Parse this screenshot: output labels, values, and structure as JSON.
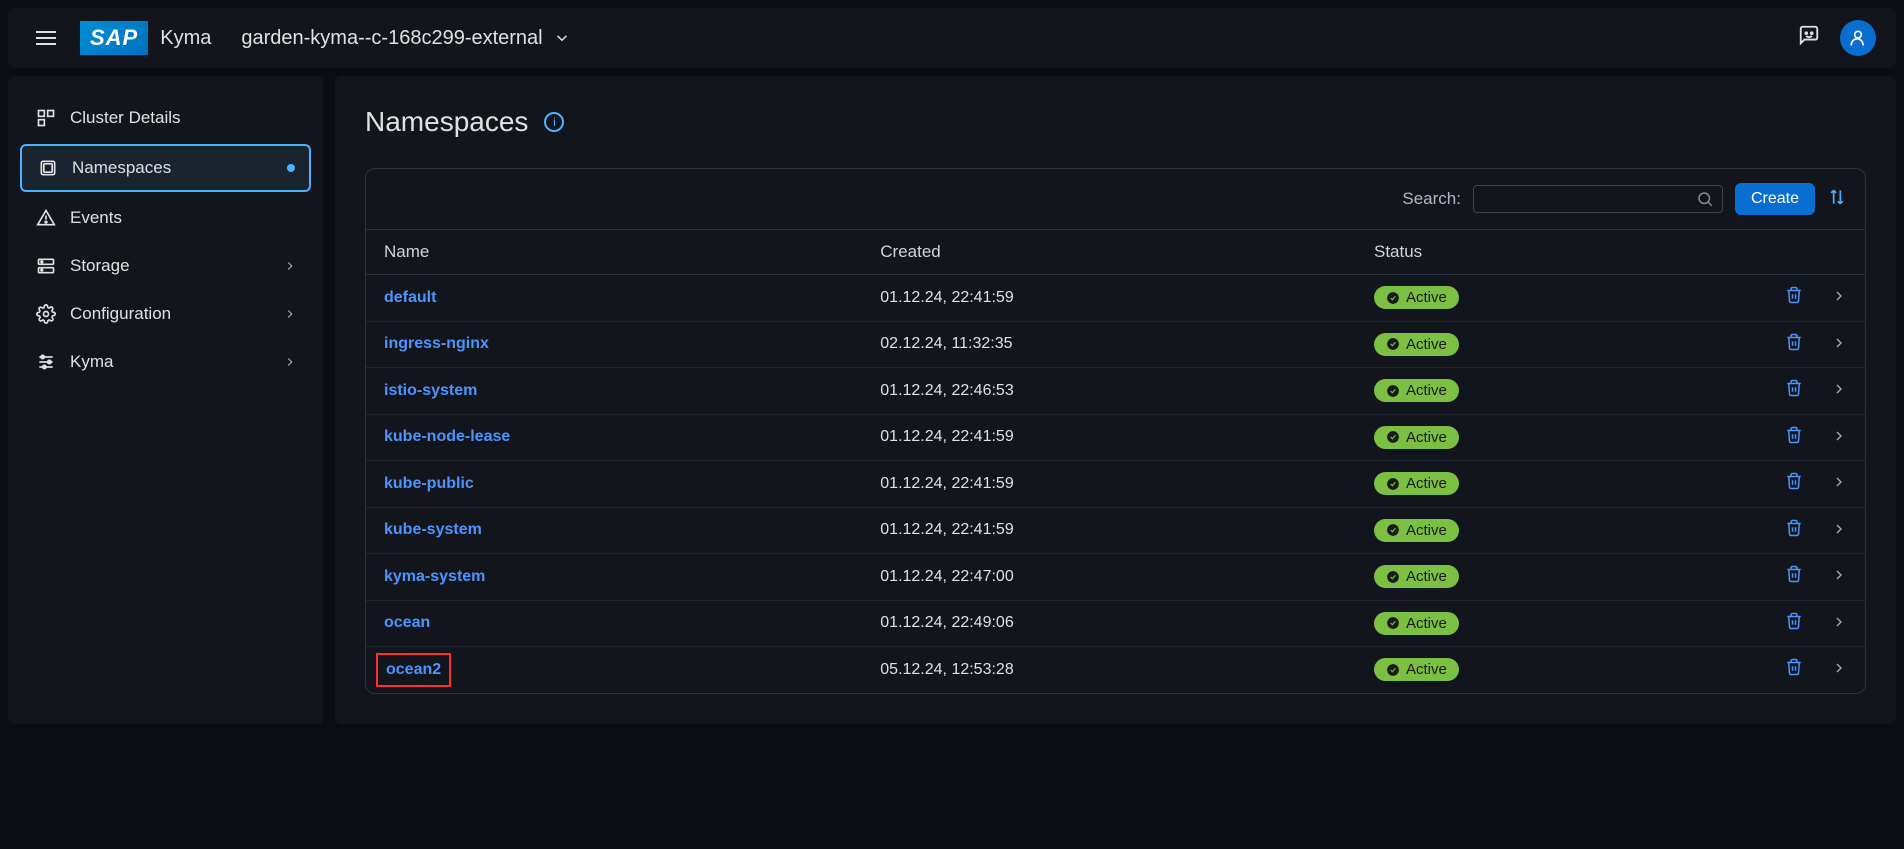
{
  "header": {
    "product": "Kyma",
    "cluster": "garden-kyma--c-168c299-external"
  },
  "sidebar": {
    "items": [
      {
        "label": "Cluster Details",
        "icon": "cluster"
      },
      {
        "label": "Namespaces",
        "icon": "namespaces",
        "active": true
      },
      {
        "label": "Events",
        "icon": "events"
      },
      {
        "label": "Storage",
        "icon": "storage",
        "expandable": true
      },
      {
        "label": "Configuration",
        "icon": "configuration",
        "expandable": true
      },
      {
        "label": "Kyma",
        "icon": "kyma",
        "expandable": true
      }
    ]
  },
  "page": {
    "title": "Namespaces",
    "search_label": "Search:",
    "create_label": "Create",
    "columns": {
      "name": "Name",
      "created": "Created",
      "status": "Status"
    }
  },
  "rows": [
    {
      "name": "default",
      "created": "01.12.24, 22:41:59",
      "status": "Active"
    },
    {
      "name": "ingress-nginx",
      "created": "02.12.24, 11:32:35",
      "status": "Active"
    },
    {
      "name": "istio-system",
      "created": "01.12.24, 22:46:53",
      "status": "Active"
    },
    {
      "name": "kube-node-lease",
      "created": "01.12.24, 22:41:59",
      "status": "Active"
    },
    {
      "name": "kube-public",
      "created": "01.12.24, 22:41:59",
      "status": "Active"
    },
    {
      "name": "kube-system",
      "created": "01.12.24, 22:41:59",
      "status": "Active"
    },
    {
      "name": "kyma-system",
      "created": "01.12.24, 22:47:00",
      "status": "Active"
    },
    {
      "name": "ocean",
      "created": "01.12.24, 22:49:06",
      "status": "Active"
    },
    {
      "name": "ocean2",
      "created": "05.12.24, 12:53:28",
      "status": "Active",
      "highlighted": true
    }
  ]
}
